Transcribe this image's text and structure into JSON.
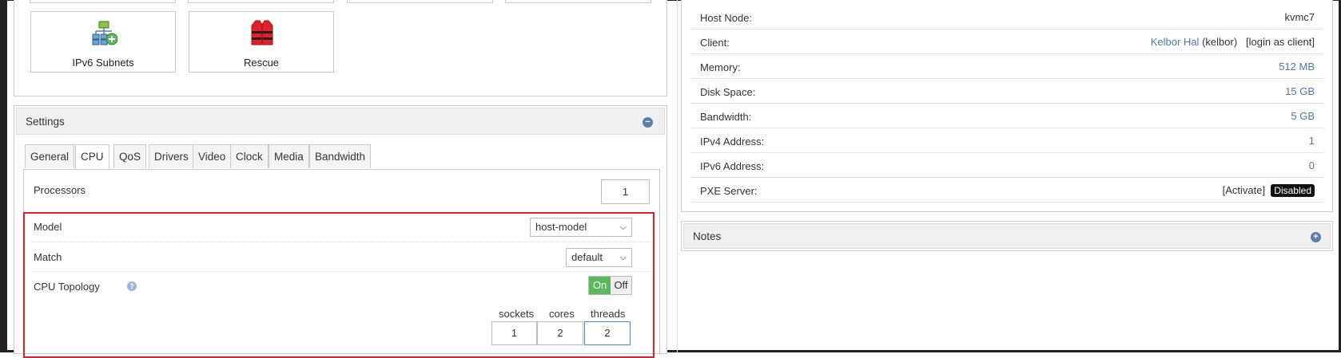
{
  "tiles": [
    {
      "label": "IPv6 Subnets",
      "icon": "network-add-icon"
    },
    {
      "label": "Rescue",
      "icon": "life-vest-icon"
    }
  ],
  "settings": {
    "title": "Settings",
    "tabs": [
      "General",
      "CPU",
      "QoS",
      "Drivers",
      "Video",
      "Clock",
      "Media",
      "Bandwidth"
    ],
    "active_tab": "CPU",
    "processors_label": "Processors",
    "processors_value": "1",
    "model_label": "Model",
    "model_value": "host-model",
    "match_label": "Match",
    "match_value": "default",
    "topology_label": "CPU Topology",
    "toggle_on": "On",
    "toggle_off": "Off",
    "sockets_label": "sockets",
    "cores_label": "cores",
    "threads_label": "threads",
    "sockets_value": "1",
    "cores_value": "2",
    "threads_value": "2"
  },
  "info": {
    "host_node_label": "Host Node:",
    "host_node_value": "kvmc7",
    "client_label": "Client:",
    "client_name": "Kelbor Hal",
    "client_user": "(kelbor)",
    "client_login": "[login as client]",
    "memory_label": "Memory:",
    "memory_value": "512 MB",
    "disk_label": "Disk Space:",
    "disk_value": "15 GB",
    "bandwidth_label": "Bandwidth:",
    "bandwidth_value": "5 GB",
    "ipv4_label": "IPv4 Address:",
    "ipv4_value": "1",
    "ipv6_label": "IPv6 Address:",
    "ipv6_value": "0",
    "pxe_label": "PXE Server:",
    "pxe_activate": "[Activate]",
    "pxe_status": "Disabled"
  },
  "notes": {
    "title": "Notes"
  },
  "colors": {
    "accent": "#4a78b0",
    "toggle_on": "#5cb85c",
    "highlight": "#e0202a"
  }
}
